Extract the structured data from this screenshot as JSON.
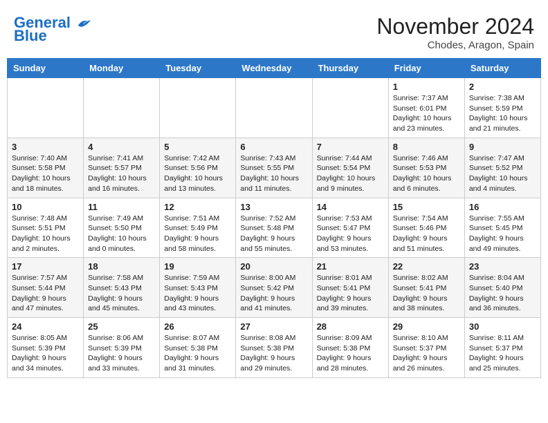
{
  "header": {
    "logo_line1": "General",
    "logo_line2": "Blue",
    "month_title": "November 2024",
    "location": "Chodes, Aragon, Spain"
  },
  "weekdays": [
    "Sunday",
    "Monday",
    "Tuesday",
    "Wednesday",
    "Thursday",
    "Friday",
    "Saturday"
  ],
  "weeks": [
    [
      {
        "day": "",
        "info": ""
      },
      {
        "day": "",
        "info": ""
      },
      {
        "day": "",
        "info": ""
      },
      {
        "day": "",
        "info": ""
      },
      {
        "day": "",
        "info": ""
      },
      {
        "day": "1",
        "info": "Sunrise: 7:37 AM\nSunset: 6:01 PM\nDaylight: 10 hours and 23 minutes."
      },
      {
        "day": "2",
        "info": "Sunrise: 7:38 AM\nSunset: 5:59 PM\nDaylight: 10 hours and 21 minutes."
      }
    ],
    [
      {
        "day": "3",
        "info": "Sunrise: 7:40 AM\nSunset: 5:58 PM\nDaylight: 10 hours and 18 minutes."
      },
      {
        "day": "4",
        "info": "Sunrise: 7:41 AM\nSunset: 5:57 PM\nDaylight: 10 hours and 16 minutes."
      },
      {
        "day": "5",
        "info": "Sunrise: 7:42 AM\nSunset: 5:56 PM\nDaylight: 10 hours and 13 minutes."
      },
      {
        "day": "6",
        "info": "Sunrise: 7:43 AM\nSunset: 5:55 PM\nDaylight: 10 hours and 11 minutes."
      },
      {
        "day": "7",
        "info": "Sunrise: 7:44 AM\nSunset: 5:54 PM\nDaylight: 10 hours and 9 minutes."
      },
      {
        "day": "8",
        "info": "Sunrise: 7:46 AM\nSunset: 5:53 PM\nDaylight: 10 hours and 6 minutes."
      },
      {
        "day": "9",
        "info": "Sunrise: 7:47 AM\nSunset: 5:52 PM\nDaylight: 10 hours and 4 minutes."
      }
    ],
    [
      {
        "day": "10",
        "info": "Sunrise: 7:48 AM\nSunset: 5:51 PM\nDaylight: 10 hours and 2 minutes."
      },
      {
        "day": "11",
        "info": "Sunrise: 7:49 AM\nSunset: 5:50 PM\nDaylight: 10 hours and 0 minutes."
      },
      {
        "day": "12",
        "info": "Sunrise: 7:51 AM\nSunset: 5:49 PM\nDaylight: 9 hours and 58 minutes."
      },
      {
        "day": "13",
        "info": "Sunrise: 7:52 AM\nSunset: 5:48 PM\nDaylight: 9 hours and 55 minutes."
      },
      {
        "day": "14",
        "info": "Sunrise: 7:53 AM\nSunset: 5:47 PM\nDaylight: 9 hours and 53 minutes."
      },
      {
        "day": "15",
        "info": "Sunrise: 7:54 AM\nSunset: 5:46 PM\nDaylight: 9 hours and 51 minutes."
      },
      {
        "day": "16",
        "info": "Sunrise: 7:55 AM\nSunset: 5:45 PM\nDaylight: 9 hours and 49 minutes."
      }
    ],
    [
      {
        "day": "17",
        "info": "Sunrise: 7:57 AM\nSunset: 5:44 PM\nDaylight: 9 hours and 47 minutes."
      },
      {
        "day": "18",
        "info": "Sunrise: 7:58 AM\nSunset: 5:43 PM\nDaylight: 9 hours and 45 minutes."
      },
      {
        "day": "19",
        "info": "Sunrise: 7:59 AM\nSunset: 5:43 PM\nDaylight: 9 hours and 43 minutes."
      },
      {
        "day": "20",
        "info": "Sunrise: 8:00 AM\nSunset: 5:42 PM\nDaylight: 9 hours and 41 minutes."
      },
      {
        "day": "21",
        "info": "Sunrise: 8:01 AM\nSunset: 5:41 PM\nDaylight: 9 hours and 39 minutes."
      },
      {
        "day": "22",
        "info": "Sunrise: 8:02 AM\nSunset: 5:41 PM\nDaylight: 9 hours and 38 minutes."
      },
      {
        "day": "23",
        "info": "Sunrise: 8:04 AM\nSunset: 5:40 PM\nDaylight: 9 hours and 36 minutes."
      }
    ],
    [
      {
        "day": "24",
        "info": "Sunrise: 8:05 AM\nSunset: 5:39 PM\nDaylight: 9 hours and 34 minutes."
      },
      {
        "day": "25",
        "info": "Sunrise: 8:06 AM\nSunset: 5:39 PM\nDaylight: 9 hours and 33 minutes."
      },
      {
        "day": "26",
        "info": "Sunrise: 8:07 AM\nSunset: 5:38 PM\nDaylight: 9 hours and 31 minutes."
      },
      {
        "day": "27",
        "info": "Sunrise: 8:08 AM\nSunset: 5:38 PM\nDaylight: 9 hours and 29 minutes."
      },
      {
        "day": "28",
        "info": "Sunrise: 8:09 AM\nSunset: 5:38 PM\nDaylight: 9 hours and 28 minutes."
      },
      {
        "day": "29",
        "info": "Sunrise: 8:10 AM\nSunset: 5:37 PM\nDaylight: 9 hours and 26 minutes."
      },
      {
        "day": "30",
        "info": "Sunrise: 8:11 AM\nSunset: 5:37 PM\nDaylight: 9 hours and 25 minutes."
      }
    ]
  ]
}
